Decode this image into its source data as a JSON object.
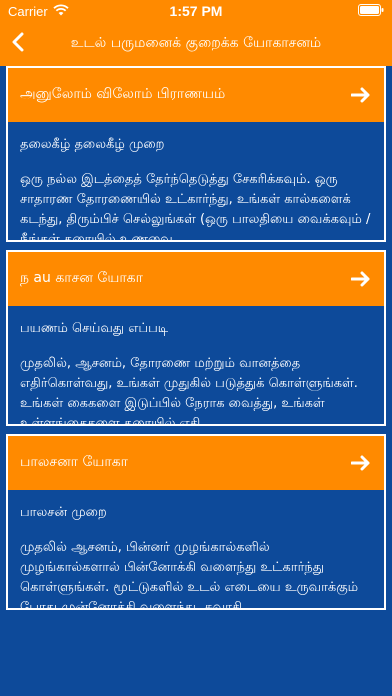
{
  "status_bar": {
    "carrier": "Carrier",
    "time": "1:57 PM"
  },
  "nav": {
    "title": "உடல் பருமனைக் குறைக்க யோகாசனம்"
  },
  "cards": [
    {
      "title": "அனுலோம் விலோம் பிராணயம்",
      "subtitle": "தலைகீழ் தலைகீழ் முறை",
      "description": "ஒரு நல்ல இடத்தைத் தேர்ந்தெடுத்து சேகரிக்கவும். ஒரு சாதாரண தோரணையில் உட்கார்ந்து, உங்கள் கால்களைக் கடந்து, திரும்பிச் செல்லுங்கள் (ஒரு பாலதியை வைக்கவும் / நீங்கள் தரையில் உணவை..."
    },
    {
      "title": "ந au காசன யோகா",
      "subtitle": "பயணம் செய்வது எப்படி",
      "description": "முதலில், ஆசனம், தோரணை மற்றும் வானத்தை எதிர்கொள்வது, உங்கள் முதுகில் படுத்துக் கொள்ளுங்கள். உங்கள் கைகளை இடுப்பில் நேராக வைத்து, உங்கள் உள்ளங்கைகளை தரையில் எதி..."
    },
    {
      "title": "பாலசனா யோகா",
      "subtitle": "பாலசன் முறை",
      "description": "முதலில் ஆசனம், பின்னர் முழங்கால்களில் முழங்கால்களால் பின்னோக்கி வளைந்து உட்கார்ந்து கொள்ளுங்கள். மூட்டுகளில் உடல் எடையை உருவாக்கும் போது முன்னோக்கி வளைந்து, சுவாசி..."
    }
  ],
  "colors": {
    "accent": "#ff8a00",
    "background": "#0d4a9a",
    "text": "#ffffff"
  }
}
